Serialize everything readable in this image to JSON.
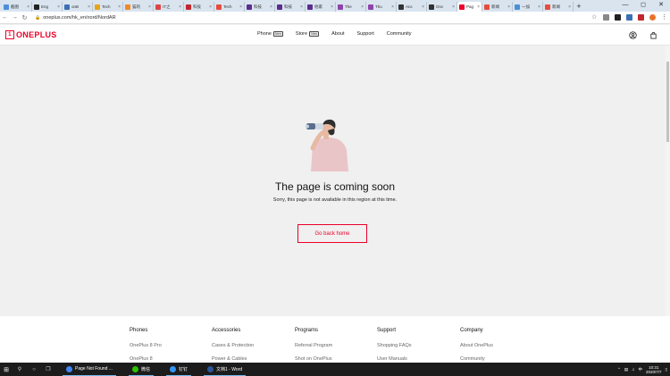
{
  "tabs": [
    {
      "label": "截图",
      "color": "#4a90d9"
    },
    {
      "label": "Eng",
      "color": "#222222"
    },
    {
      "label": "onB",
      "color": "#3a6fb5"
    },
    {
      "label": "Tech",
      "color": "#e8a317"
    },
    {
      "label": "猫的",
      "color": "#f08a24"
    },
    {
      "label": "IT之",
      "color": "#d44"
    },
    {
      "label": "科技",
      "color": "#c1272d"
    },
    {
      "label": "Tech",
      "color": "#e74c3c"
    },
    {
      "label": "科技",
      "color": "#5b2c8f"
    },
    {
      "label": "科技",
      "color": "#5b2c8f"
    },
    {
      "label": "他家",
      "color": "#5b2c8f"
    },
    {
      "label": "The",
      "color": "#8e44ad"
    },
    {
      "label": "Thu",
      "color": "#8e44ad"
    },
    {
      "label": "Anc",
      "color": "#333333"
    },
    {
      "label": "Onc",
      "color": "#333333"
    },
    {
      "label": "Pag",
      "color": "#eb0029",
      "active": true
    },
    {
      "label": "新闻",
      "color": "#e74c3c"
    },
    {
      "label": "一加",
      "color": "#4a90d9"
    },
    {
      "label": "新闻",
      "color": "#e74c3c"
    }
  ],
  "address": {
    "url": "oneplus.com/hk_en/nord/NordAR"
  },
  "brand": {
    "name": "ONEPLUS",
    "mark": "1"
  },
  "nav": [
    {
      "label": "Phone",
      "badge": "New"
    },
    {
      "label": "Store",
      "badge": "New"
    },
    {
      "label": "About",
      "badge": ""
    },
    {
      "label": "Support",
      "badge": ""
    },
    {
      "label": "Community",
      "badge": ""
    }
  ],
  "main": {
    "title": "The page is coming soon",
    "subtitle": "Sorry, this page is not available in this region at this time.",
    "button": "Go back home"
  },
  "footer": [
    {
      "heading": "Phones",
      "links": [
        "OnePlus 8 Pro",
        "OnePlus 8"
      ]
    },
    {
      "heading": "Accessories",
      "links": [
        "Cases & Protection",
        "Power & Cables"
      ]
    },
    {
      "heading": "Programs",
      "links": [
        "Referral Program",
        "Shot on OnePlus"
      ]
    },
    {
      "heading": "Support",
      "links": [
        "Shopping FAQs",
        "User Manuals"
      ]
    },
    {
      "heading": "Company",
      "links": [
        "About OnePlus",
        "Community"
      ]
    }
  ],
  "taskbar": {
    "tasks": [
      {
        "label": "Page Not Found ...",
        "color": "#4285f4"
      },
      {
        "label": "微信",
        "color": "#2dc100"
      },
      {
        "label": "钉钉",
        "color": "#3296fa"
      },
      {
        "label": "文档1 - Word",
        "color": "#2b579a"
      }
    ],
    "time": "10:31",
    "date": "2020/7/7",
    "ime": "中"
  },
  "colors": {
    "accent": "#eb0029"
  }
}
